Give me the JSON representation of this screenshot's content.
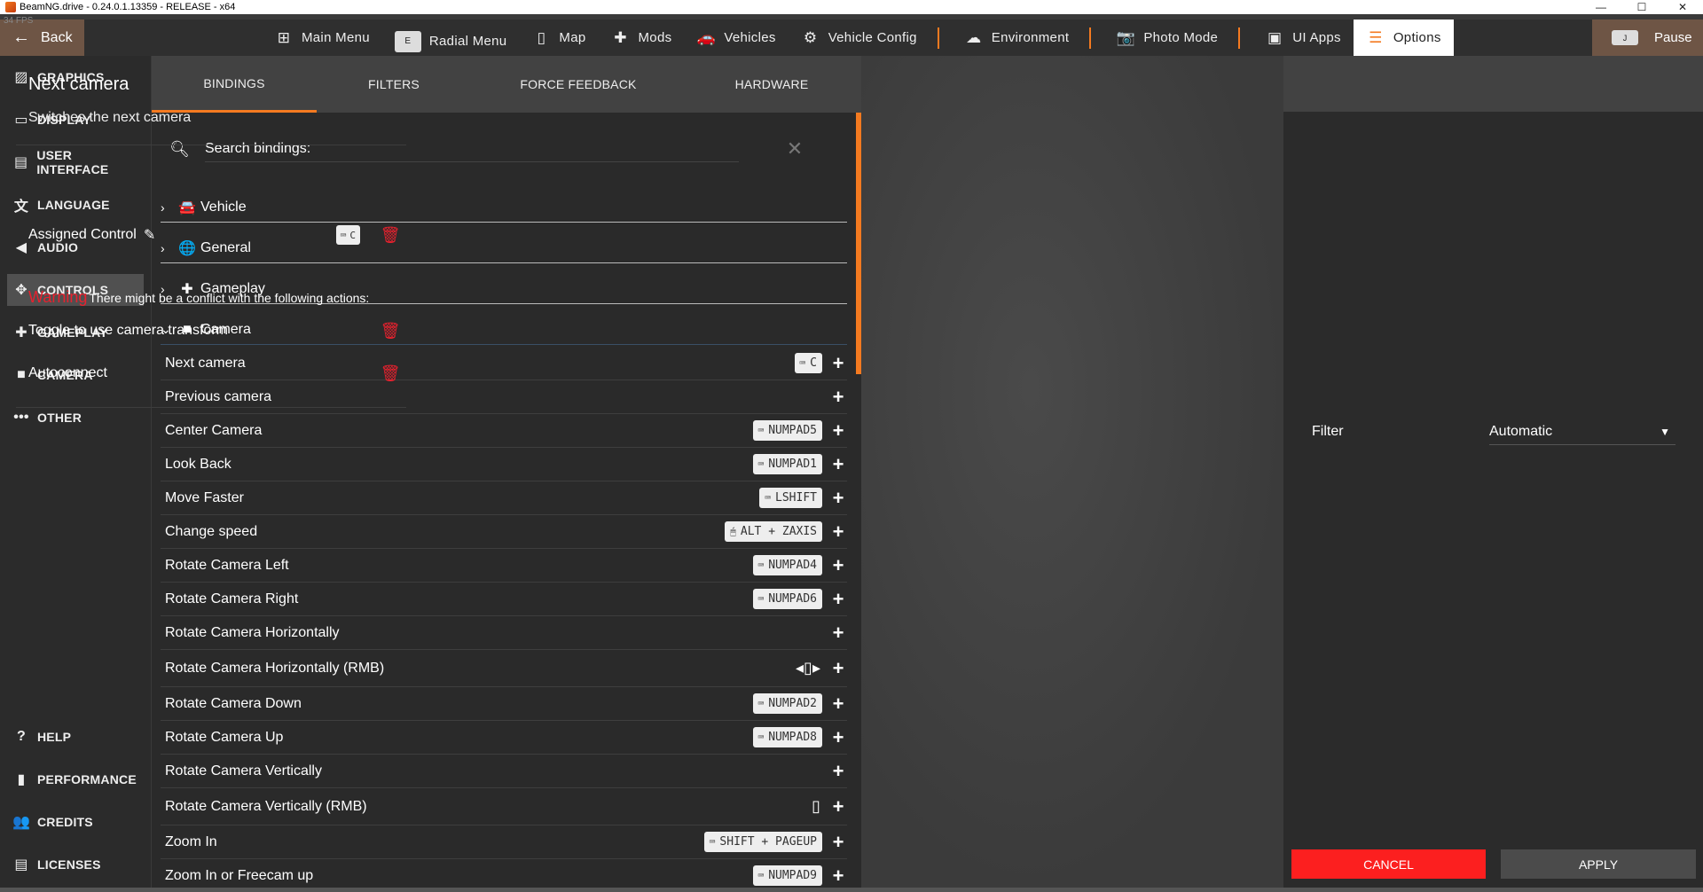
{
  "window": {
    "title": "BeamNG.drive - 0.24.0.1.13359 - RELEASE - x64",
    "fps": "34 FPS",
    "minimize": "—",
    "maximize": "☐",
    "close": "✕"
  },
  "topbar": {
    "back_label": "Back",
    "pause_label": "Pause",
    "pause_key": "J",
    "nav": [
      {
        "label": "Main Menu",
        "icon": "⊞"
      },
      {
        "label": "Radial Menu",
        "icon": "E"
      },
      {
        "label": "Map",
        "icon": "▯"
      },
      {
        "label": "Mods",
        "icon": "✚"
      },
      {
        "label": "Vehicles",
        "icon": "🚗"
      },
      {
        "label": "Vehicle Config",
        "icon": "⚙"
      },
      {
        "label": "Environment",
        "icon": "☁"
      },
      {
        "label": "Photo Mode",
        "icon": "📷"
      },
      {
        "label": "UI Apps",
        "icon": "▣"
      },
      {
        "label": "Options",
        "icon": "☰"
      }
    ]
  },
  "sidebar": {
    "items": [
      {
        "label": "GRAPHICS",
        "icon": "▨"
      },
      {
        "label": "DISPLAY",
        "icon": "▭"
      },
      {
        "label": "USER INTERFACE",
        "icon": "▤"
      },
      {
        "label": "LANGUAGE",
        "icon": "文"
      },
      {
        "label": "AUDIO",
        "icon": "◀"
      },
      {
        "label": "CONTROLS",
        "icon": "✥"
      },
      {
        "label": "GAMEPLAY",
        "icon": "✚"
      },
      {
        "label": "CAMERA",
        "icon": "■"
      },
      {
        "label": "OTHER",
        "icon": "•••"
      }
    ],
    "bottom_items": [
      {
        "label": "HELP",
        "icon": "?"
      },
      {
        "label": "PERFORMANCE",
        "icon": "▮"
      },
      {
        "label": "CREDITS",
        "icon": "👥"
      },
      {
        "label": "LICENSES",
        "icon": "▤"
      }
    ]
  },
  "tabs": [
    "BINDINGS",
    "FILTERS",
    "FORCE FEEDBACK",
    "HARDWARE"
  ],
  "search": {
    "label": "Search bindings:",
    "clear": "✕"
  },
  "groups": [
    {
      "label": "Vehicle",
      "icon": "🚘",
      "chev": "›"
    },
    {
      "label": "General",
      "icon": "🌐",
      "chev": "›"
    },
    {
      "label": "Gameplay",
      "icon": "✚",
      "chev": "›"
    },
    {
      "label": "Camera",
      "icon": "■",
      "chev": "⌄"
    }
  ],
  "bindings": [
    {
      "label": "Next camera",
      "key": "C",
      "kind": "kb"
    },
    {
      "label": "Previous camera",
      "key": "",
      "kind": "none"
    },
    {
      "label": "Center Camera",
      "key": "NUMPAD5",
      "kind": "kb"
    },
    {
      "label": "Look Back",
      "key": "NUMPAD1",
      "kind": "kb"
    },
    {
      "label": "Move Faster",
      "key": "LSHIFT",
      "kind": "kb"
    },
    {
      "label": "Change speed",
      "key": "ALT + ZAXIS",
      "kind": "mouse"
    },
    {
      "label": "Rotate Camera Left",
      "key": "NUMPAD4",
      "kind": "kb"
    },
    {
      "label": "Rotate Camera Right",
      "key": "NUMPAD6",
      "kind": "kb"
    },
    {
      "label": "Rotate Camera Horizontally",
      "key": "",
      "kind": "none"
    },
    {
      "label": "Rotate Camera Horizontally (RMB)",
      "key": "◂▯▸",
      "kind": "icon"
    },
    {
      "label": "Rotate Camera Down",
      "key": "NUMPAD2",
      "kind": "kb"
    },
    {
      "label": "Rotate Camera Up",
      "key": "NUMPAD8",
      "kind": "kb"
    },
    {
      "label": "Rotate Camera Vertically",
      "key": "",
      "kind": "none"
    },
    {
      "label": "Rotate Camera Vertically (RMB)",
      "key": "▯",
      "kind": "icon"
    },
    {
      "label": "Zoom In",
      "key": "SHIFT + PAGEUP",
      "kind": "kb"
    },
    {
      "label": "Zoom In or Freecam up",
      "key": "NUMPAD9",
      "kind": "kb"
    }
  ],
  "detail": {
    "title": "Next camera",
    "description": "Switches the next camera",
    "assigned_label": "Assigned Control",
    "assigned_key": "C",
    "warning_word": "Warning",
    "warning_text": "There might be a conflict with the following actions:",
    "conflicts": [
      "Toggle to use camera transform",
      "Autoconnect"
    ],
    "filter_label": "Filter",
    "filter_value": "Automatic",
    "cancel_label": "CANCEL",
    "apply_label": "APPLY"
  },
  "colors": {
    "accent": "#f47a20",
    "danger": "#e8212e",
    "cancel": "#fc1f1f"
  }
}
